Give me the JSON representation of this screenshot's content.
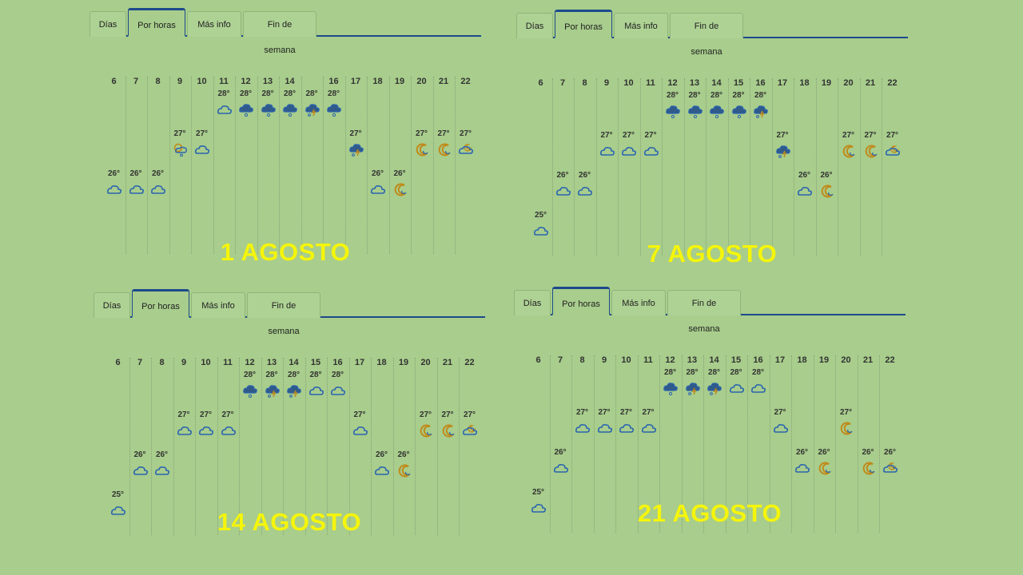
{
  "tabs": [
    "Días",
    "Por horas",
    "Más info",
    "Fin de semana"
  ],
  "active_tab": 1,
  "panels": [
    {
      "caption": "1 AGOSTO",
      "hours": [
        {
          "h": "6",
          "t": "26°",
          "icon": "cloud"
        },
        {
          "h": "7",
          "t": "26°",
          "icon": "cloud"
        },
        {
          "h": "8",
          "t": "26°",
          "icon": "cloud"
        },
        {
          "h": "9",
          "t": "27°",
          "icon": "sun-cloud-rain"
        },
        {
          "h": "10",
          "t": "27°",
          "icon": "cloud"
        },
        {
          "h": "11",
          "t": "28°",
          "icon": "cloud"
        },
        {
          "h": "12",
          "t": "28°",
          "icon": "rain"
        },
        {
          "h": "13",
          "t": "28°",
          "icon": "rain"
        },
        {
          "h": "14",
          "t": "28°",
          "icon": "rain"
        },
        {
          "h": "",
          "t": "28°",
          "icon": "storm"
        },
        {
          "h": "16",
          "t": "28°",
          "icon": "rain"
        },
        {
          "h": "17",
          "t": "27°",
          "icon": "storm"
        },
        {
          "h": "18",
          "t": "26°",
          "icon": "cloud"
        },
        {
          "h": "19",
          "t": "26°",
          "icon": "moon"
        },
        {
          "h": "20",
          "t": "27°",
          "icon": "moon"
        },
        {
          "h": "21",
          "t": "27°",
          "icon": "moon"
        },
        {
          "h": "22",
          "t": "27°",
          "icon": "moon-cloud"
        }
      ]
    },
    {
      "caption": "7 AGOSTO",
      "hours": [
        {
          "h": "6",
          "t": "25°",
          "icon": "cloud"
        },
        {
          "h": "7",
          "t": "26°",
          "icon": "cloud"
        },
        {
          "h": "8",
          "t": "26°",
          "icon": "cloud"
        },
        {
          "h": "9",
          "t": "27°",
          "icon": "cloud"
        },
        {
          "h": "10",
          "t": "27°",
          "icon": "cloud"
        },
        {
          "h": "11",
          "t": "27°",
          "icon": "cloud"
        },
        {
          "h": "12",
          "t": "28°",
          "icon": "rain"
        },
        {
          "h": "13",
          "t": "28°",
          "icon": "rain"
        },
        {
          "h": "14",
          "t": "28°",
          "icon": "rain"
        },
        {
          "h": "15",
          "t": "28°",
          "icon": "rain"
        },
        {
          "h": "16",
          "t": "28°",
          "icon": "storm"
        },
        {
          "h": "17",
          "t": "27°",
          "icon": "storm"
        },
        {
          "h": "18",
          "t": "26°",
          "icon": "cloud"
        },
        {
          "h": "19",
          "t": "26°",
          "icon": "moon"
        },
        {
          "h": "20",
          "t": "27°",
          "icon": "moon"
        },
        {
          "h": "21",
          "t": "27°",
          "icon": "moon"
        },
        {
          "h": "22",
          "t": "27°",
          "icon": "moon-cloud"
        }
      ]
    },
    {
      "caption": "14 AGOSTO",
      "hours": [
        {
          "h": "6",
          "t": "25°",
          "icon": "cloud"
        },
        {
          "h": "7",
          "t": "26°",
          "icon": "cloud"
        },
        {
          "h": "8",
          "t": "26°",
          "icon": "cloud"
        },
        {
          "h": "9",
          "t": "27°",
          "icon": "cloud"
        },
        {
          "h": "10",
          "t": "27°",
          "icon": "cloud"
        },
        {
          "h": "11",
          "t": "27°",
          "icon": "cloud"
        },
        {
          "h": "12",
          "t": "28°",
          "icon": "rain"
        },
        {
          "h": "13",
          "t": "28°",
          "icon": "storm"
        },
        {
          "h": "14",
          "t": "28°",
          "icon": "storm"
        },
        {
          "h": "15",
          "t": "28°",
          "icon": "cloud"
        },
        {
          "h": "16",
          "t": "28°",
          "icon": "cloud"
        },
        {
          "h": "17",
          "t": "27°",
          "icon": "cloud"
        },
        {
          "h": "18",
          "t": "26°",
          "icon": "cloud"
        },
        {
          "h": "19",
          "t": "26°",
          "icon": "moon"
        },
        {
          "h": "20",
          "t": "27°",
          "icon": "moon"
        },
        {
          "h": "21",
          "t": "27°",
          "icon": "moon"
        },
        {
          "h": "22",
          "t": "27°",
          "icon": "moon-cloud"
        }
      ]
    },
    {
      "caption": "21 AGOSTO",
      "hours": [
        {
          "h": "6",
          "t": "25°",
          "icon": "cloud"
        },
        {
          "h": "7",
          "t": "26°",
          "icon": "cloud"
        },
        {
          "h": "8",
          "t": "27°",
          "icon": "cloud"
        },
        {
          "h": "9",
          "t": "27°",
          "icon": "cloud"
        },
        {
          "h": "10",
          "t": "27°",
          "icon": "cloud"
        },
        {
          "h": "11",
          "t": "27°",
          "icon": "cloud"
        },
        {
          "h": "12",
          "t": "28°",
          "icon": "rain"
        },
        {
          "h": "13",
          "t": "28°",
          "icon": "storm"
        },
        {
          "h": "14",
          "t": "28°",
          "icon": "storm"
        },
        {
          "h": "15",
          "t": "28°",
          "icon": "cloud"
        },
        {
          "h": "16",
          "t": "28°",
          "icon": "cloud"
        },
        {
          "h": "17",
          "t": "27°",
          "icon": "cloud"
        },
        {
          "h": "18",
          "t": "26°",
          "icon": "cloud"
        },
        {
          "h": "19",
          "t": "26°",
          "icon": "moon"
        },
        {
          "h": "20",
          "t": "27°",
          "icon": "moon"
        },
        {
          "h": "21",
          "t": "26°",
          "icon": "moon"
        },
        {
          "h": "22",
          "t": "26°",
          "icon": "moon-cloud"
        }
      ]
    }
  ],
  "colors": {
    "tab_border": "#1d4a8c",
    "icon_blue": "#2a64b0",
    "icon_dark": "#2f5a8a",
    "moon": "#c08a1a",
    "caption": "#f5f50a"
  }
}
